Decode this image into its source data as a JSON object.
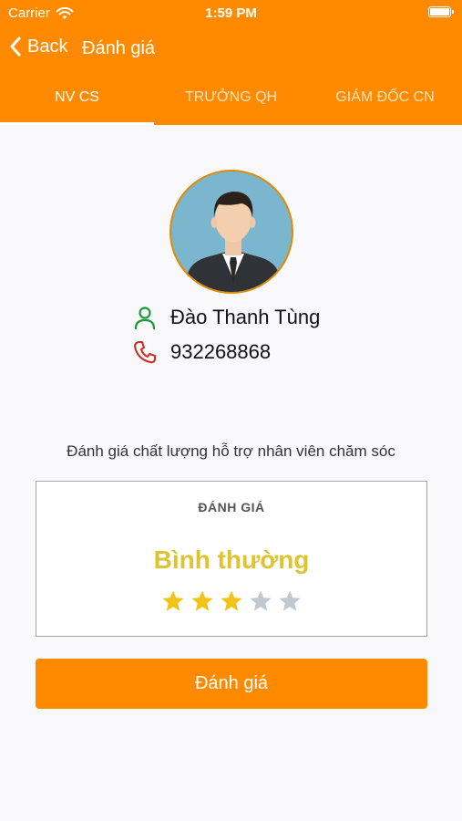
{
  "status_bar": {
    "carrier": "Carrier",
    "time": "1:59 PM",
    "wifi_icon": "wifi-icon",
    "battery_icon": "battery-icon"
  },
  "nav": {
    "back_label": "Back",
    "title": "Đánh giá"
  },
  "tabs": [
    {
      "label": "NV CS",
      "active": true
    },
    {
      "label": "TRƯỞNG QH",
      "active": false
    },
    {
      "label": "GIÁM ĐỐC CN",
      "active": false
    }
  ],
  "profile": {
    "name": "Đào Thanh Tùng",
    "phone": "932268868",
    "name_icon": "person-icon",
    "phone_icon": "phone-icon"
  },
  "rating_prompt": "Đánh giá chất lượng hỗ trợ nhân viên chăm sóc",
  "rating": {
    "header": "ĐÁNH GIÁ",
    "value_label": "Bình thường",
    "stars": 3,
    "max_stars": 5
  },
  "submit_label": "Đánh giá",
  "colors": {
    "brand": "#ff8a00",
    "rating_text": "#e0c331",
    "star_filled": "#f2c318",
    "star_empty": "#c3c7cf",
    "name_icon": "#1a9a3b",
    "phone_icon": "#d0271f"
  }
}
